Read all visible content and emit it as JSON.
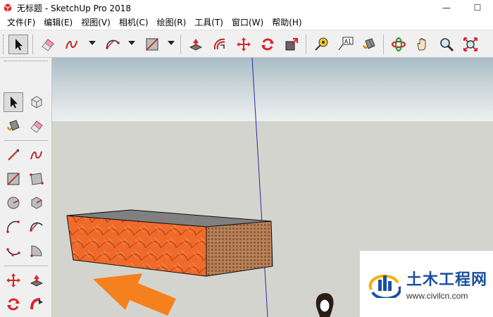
{
  "window": {
    "title": "无标题 - SketchUp Pro 2018",
    "minimize_glyph": "—",
    "maximize_glyph": "☐"
  },
  "menubar": {
    "items": [
      {
        "label": "文件(F)"
      },
      {
        "label": "编辑(E)"
      },
      {
        "label": "视图(V)"
      },
      {
        "label": "相机(C)"
      },
      {
        "label": "绘图(R)"
      },
      {
        "label": "工具(T)"
      },
      {
        "label": "窗口(W)"
      },
      {
        "label": "帮助(H)"
      }
    ]
  },
  "toolbar": {
    "tools": [
      "select-icon",
      "eraser-icon",
      "freehand-icon",
      "arc-icon",
      "rectangle-icon",
      "push-pull-icon",
      "offset-icon",
      "move-icon",
      "rotate-icon",
      "scale-icon",
      "tape-measure-icon",
      "text-icon",
      "paint-bucket-icon",
      "orbit-icon",
      "pan-icon",
      "zoom-icon",
      "zoom-extents-icon"
    ],
    "text_tool_label": "A1"
  },
  "lefttoolbar": {
    "tools": [
      "select-icon",
      "component-icon",
      "paint-bucket-icon",
      "eraser-icon",
      "line-icon",
      "freehand-icon",
      "rectangle-icon",
      "rotated-rectangle-icon",
      "circle-icon",
      "polygon-icon",
      "arc-icon",
      "two-point-arc-icon",
      "three-point-arc-icon",
      "pie-icon",
      "move-icon",
      "push-pull-icon",
      "rotate-icon",
      "follow-me-icon"
    ]
  },
  "colors": {
    "brick_face": "#f06a2a",
    "brick_end": "#b9835b",
    "box_top": "#808080",
    "arrow": "#f5801e",
    "axis_blue": "#2a2aa8",
    "watermark_blue": "#1b4fa0"
  },
  "watermark": {
    "name": "土木工程网",
    "url": "www.civilcn.com"
  }
}
